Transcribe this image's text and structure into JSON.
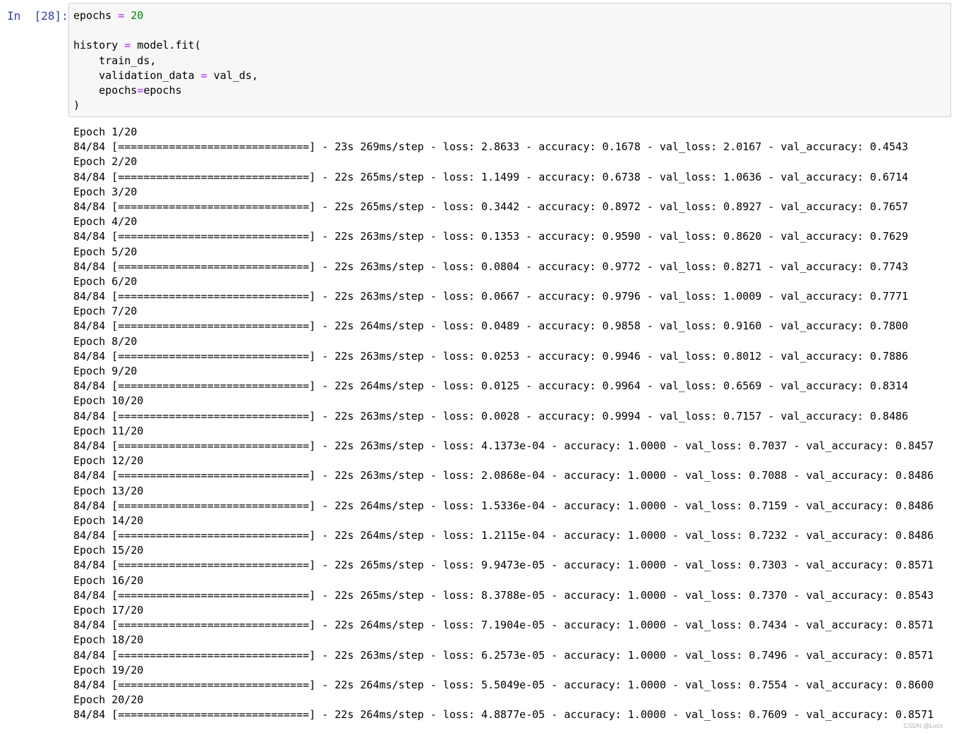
{
  "cell": {
    "prompt": "In  [28]:",
    "code_lines": [
      "epochs = 20",
      "",
      "history = model.fit(",
      "    train_ds,",
      "    validation_data = val_ds,",
      "    epochs=epochs",
      ")"
    ]
  },
  "output_lines": [
    "Epoch 1/20",
    "84/84 [==============================] - 23s 269ms/step - loss: 2.8633 - accuracy: 0.1678 - val_loss: 2.0167 - val_accuracy: 0.4543",
    "Epoch 2/20",
    "84/84 [==============================] - 22s 265ms/step - loss: 1.1499 - accuracy: 0.6738 - val_loss: 1.0636 - val_accuracy: 0.6714",
    "Epoch 3/20",
    "84/84 [==============================] - 22s 265ms/step - loss: 0.3442 - accuracy: 0.8972 - val_loss: 0.8927 - val_accuracy: 0.7657",
    "Epoch 4/20",
    "84/84 [==============================] - 22s 263ms/step - loss: 0.1353 - accuracy: 0.9590 - val_loss: 0.8620 - val_accuracy: 0.7629",
    "Epoch 5/20",
    "84/84 [==============================] - 22s 263ms/step - loss: 0.0804 - accuracy: 0.9772 - val_loss: 0.8271 - val_accuracy: 0.7743",
    "Epoch 6/20",
    "84/84 [==============================] - 22s 263ms/step - loss: 0.0667 - accuracy: 0.9796 - val_loss: 1.0009 - val_accuracy: 0.7771",
    "Epoch 7/20",
    "84/84 [==============================] - 22s 264ms/step - loss: 0.0489 - accuracy: 0.9858 - val_loss: 0.9160 - val_accuracy: 0.7800",
    "Epoch 8/20",
    "84/84 [==============================] - 22s 263ms/step - loss: 0.0253 - accuracy: 0.9946 - val_loss: 0.8012 - val_accuracy: 0.7886",
    "Epoch 9/20",
    "84/84 [==============================] - 22s 264ms/step - loss: 0.0125 - accuracy: 0.9964 - val_loss: 0.6569 - val_accuracy: 0.8314",
    "Epoch 10/20",
    "84/84 [==============================] - 22s 263ms/step - loss: 0.0028 - accuracy: 0.9994 - val_loss: 0.7157 - val_accuracy: 0.8486",
    "Epoch 11/20",
    "84/84 [==============================] - 22s 263ms/step - loss: 4.1373e-04 - accuracy: 1.0000 - val_loss: 0.7037 - val_accuracy: 0.8457",
    "Epoch 12/20",
    "84/84 [==============================] - 22s 263ms/step - loss: 2.0868e-04 - accuracy: 1.0000 - val_loss: 0.7088 - val_accuracy: 0.8486",
    "Epoch 13/20",
    "84/84 [==============================] - 22s 264ms/step - loss: 1.5336e-04 - accuracy: 1.0000 - val_loss: 0.7159 - val_accuracy: 0.8486",
    "Epoch 14/20",
    "84/84 [==============================] - 22s 264ms/step - loss: 1.2115e-04 - accuracy: 1.0000 - val_loss: 0.7232 - val_accuracy: 0.8486",
    "Epoch 15/20",
    "84/84 [==============================] - 22s 265ms/step - loss: 9.9473e-05 - accuracy: 1.0000 - val_loss: 0.7303 - val_accuracy: 0.8571",
    "Epoch 16/20",
    "84/84 [==============================] - 22s 265ms/step - loss: 8.3788e-05 - accuracy: 1.0000 - val_loss: 0.7370 - val_accuracy: 0.8543",
    "Epoch 17/20",
    "84/84 [==============================] - 22s 264ms/step - loss: 7.1904e-05 - accuracy: 1.0000 - val_loss: 0.7434 - val_accuracy: 0.8571",
    "Epoch 18/20",
    "84/84 [==============================] - 22s 263ms/step - loss: 6.2573e-05 - accuracy: 1.0000 - val_loss: 0.7496 - val_accuracy: 0.8571",
    "Epoch 19/20",
    "84/84 [==============================] - 22s 264ms/step - loss: 5.5049e-05 - accuracy: 1.0000 - val_loss: 0.7554 - val_accuracy: 0.8600",
    "Epoch 20/20",
    "84/84 [==============================] - 22s 264ms/step - loss: 4.8877e-05 - accuracy: 1.0000 - val_loss: 0.7609 - val_accuracy: 0.8571"
  ],
  "watermark": "CSDN @Lvcx",
  "colors": {
    "prompt": "#303f9f",
    "cell_background": "#f7f7f7",
    "cell_border": "#cfcfcf",
    "operator": "#aa22ff",
    "number": "#008800"
  }
}
